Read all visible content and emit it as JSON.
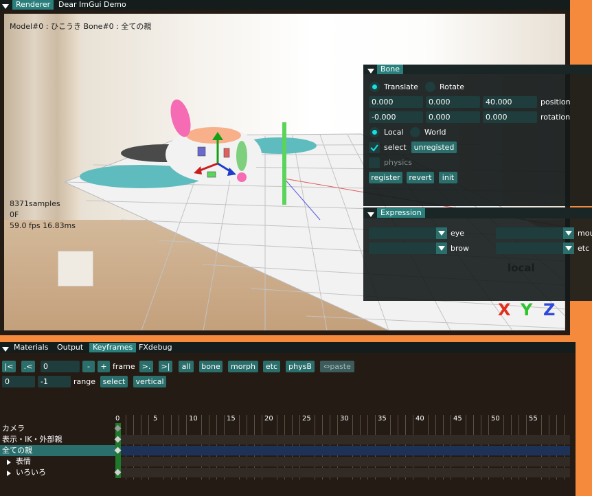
{
  "top_tabs": [
    "Renderer",
    "Dear ImGui Demo"
  ],
  "viewport": {
    "overlay_model": "Model#0 : ひこうき Bone#0 : 全ての親",
    "samples": "8371samples",
    "frame": "0F",
    "fps": "59.0 fps 16.83ms",
    "gizmo_label": "local"
  },
  "bone_panel": {
    "title": "Bone",
    "translate": "Translate",
    "rotate": "Rotate",
    "position": [
      "0.000",
      "0.000",
      "40.000"
    ],
    "position_label": "position",
    "rotation": [
      "-0.000",
      "0.000",
      "0.000"
    ],
    "rotation_label": "rotation",
    "local": "Local",
    "world": "World",
    "select": "select",
    "unregisted": "unregisted",
    "physics": "physics",
    "register": "register",
    "revert": "revert",
    "init": "init"
  },
  "expression_panel": {
    "title": "Expression",
    "eye": "eye",
    "mouth": "mou",
    "brow": "brow",
    "etc": "etc"
  },
  "bottom_tabs": [
    "Materials",
    "Output",
    "Keyframes",
    "FXdebug"
  ],
  "keyframes": {
    "btn_first": "|<",
    "btn_prev": ".<",
    "frame_value": "0",
    "minus": "-",
    "plus": "+",
    "frame_label": "frame",
    "btn_next": ">.",
    "btn_last": ">|",
    "all": "all",
    "bone": "bone",
    "morph": "morph",
    "etc": "etc",
    "physB": "physB",
    "paste": "⇔paste",
    "range_start": "0",
    "range_end": "-1",
    "range_label": "range",
    "select": "select",
    "vertical": "vertical",
    "ticks": [
      "0",
      "5",
      "10",
      "15",
      "20",
      "25",
      "30",
      "35",
      "40",
      "45",
      "50",
      "55"
    ],
    "tracks": [
      "カメラ",
      "表示・IK・外部親",
      "全ての親",
      "表情",
      "いろいろ"
    ]
  },
  "colors": {
    "accent": "#2a7f7c",
    "button": "#2a6f6c",
    "radio_on": "#17e0e0",
    "background": "#f58a3c"
  }
}
